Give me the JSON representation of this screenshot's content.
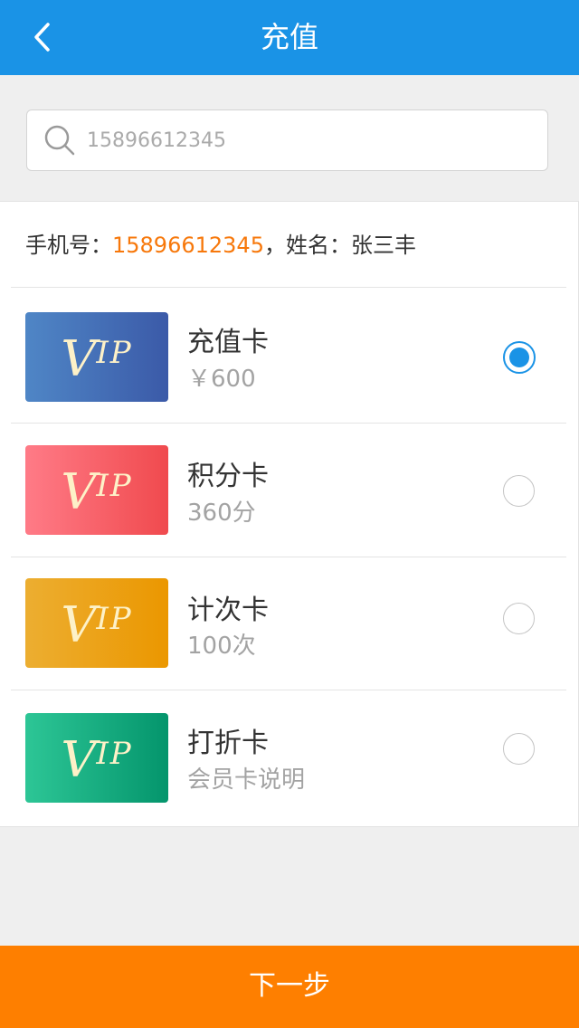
{
  "header": {
    "title": "充值",
    "back_icon": "chevron-left-icon",
    "background_color": "#1a93e6"
  },
  "search": {
    "value": "",
    "placeholder": "15896612345",
    "icon": "search-icon"
  },
  "user": {
    "phone_label": "手机号：",
    "phone": "15896612345",
    "name_label": "，姓名：",
    "name": "张三丰",
    "phone_color": "#f7780b"
  },
  "cards": [
    {
      "badge_text_v": "V",
      "badge_text_ip": "IP",
      "name": "充值卡",
      "detail": "￥600",
      "selected": true,
      "gradient": [
        "#4f86c6",
        "#3b5aa8"
      ]
    },
    {
      "badge_text_v": "V",
      "badge_text_ip": "IP",
      "name": "积分卡",
      "detail": "360分",
      "selected": false,
      "gradient": [
        "#ff7b87",
        "#f04a4e"
      ]
    },
    {
      "badge_text_v": "V",
      "badge_text_ip": "IP",
      "name": "计次卡",
      "detail": "100次",
      "selected": false,
      "gradient": [
        "#ecae31",
        "#eb9700"
      ]
    },
    {
      "badge_text_v": "V",
      "badge_text_ip": "IP",
      "name": "打折卡",
      "detail": "会员卡说明",
      "selected": false,
      "gradient": [
        "#2dc696",
        "#04956c"
      ]
    }
  ],
  "footer": {
    "next_label": "下一步",
    "background_color": "#fe7f00"
  }
}
